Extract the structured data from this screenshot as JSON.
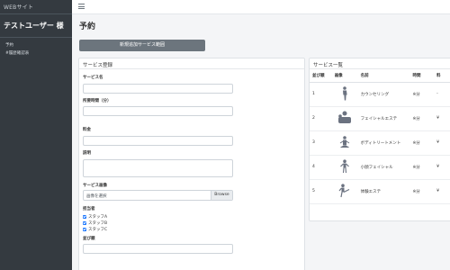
{
  "brand": "WEBサイト",
  "user_name": "テストユーザー 様",
  "sidebar": {
    "items": [
      {
        "label": "予約"
      },
      {
        "label": "#履歴確認表"
      }
    ]
  },
  "page_title": "予約",
  "add_button_label": "新規追加サービス範囲",
  "form": {
    "title": "サービス登録",
    "fields": {
      "service_name": "サービス名",
      "duration": "所要時間（分）",
      "price": "料金",
      "description": "説明",
      "image": "サービス画像",
      "staff": "担当者",
      "order": "並び順"
    },
    "file_placeholder": "画像を選択",
    "browse_label": "Browse",
    "staff_options": [
      "スタッフA",
      "スタッフB",
      "スタッフC"
    ]
  },
  "table": {
    "title": "サービス一覧",
    "columns": [
      "並び順",
      "画像",
      "名前",
      "時間",
      "料"
    ],
    "rows": [
      {
        "order": "1",
        "icon": "person-standing-icon",
        "name": "カウンセリング",
        "time": "※分",
        "price": "-"
      },
      {
        "order": "2",
        "icon": "facial-treatment-icon",
        "name": "フェイシャルエステ",
        "time": "※分",
        "price": "¥"
      },
      {
        "order": "3",
        "icon": "meditation-icon",
        "name": "ボディトリートメント",
        "time": "※分",
        "price": "¥"
      },
      {
        "order": "4",
        "icon": "person-arms-out-icon",
        "name": "小顔フェイシャル",
        "time": "※分",
        "price": "¥"
      },
      {
        "order": "5",
        "icon": "kick-pose-icon",
        "name": "体験エステ",
        "time": "※分",
        "price": "¥"
      }
    ]
  },
  "colors": {
    "sidebar": "#343a40",
    "button": "#6c757d",
    "checkbox": "#0d6efd"
  }
}
